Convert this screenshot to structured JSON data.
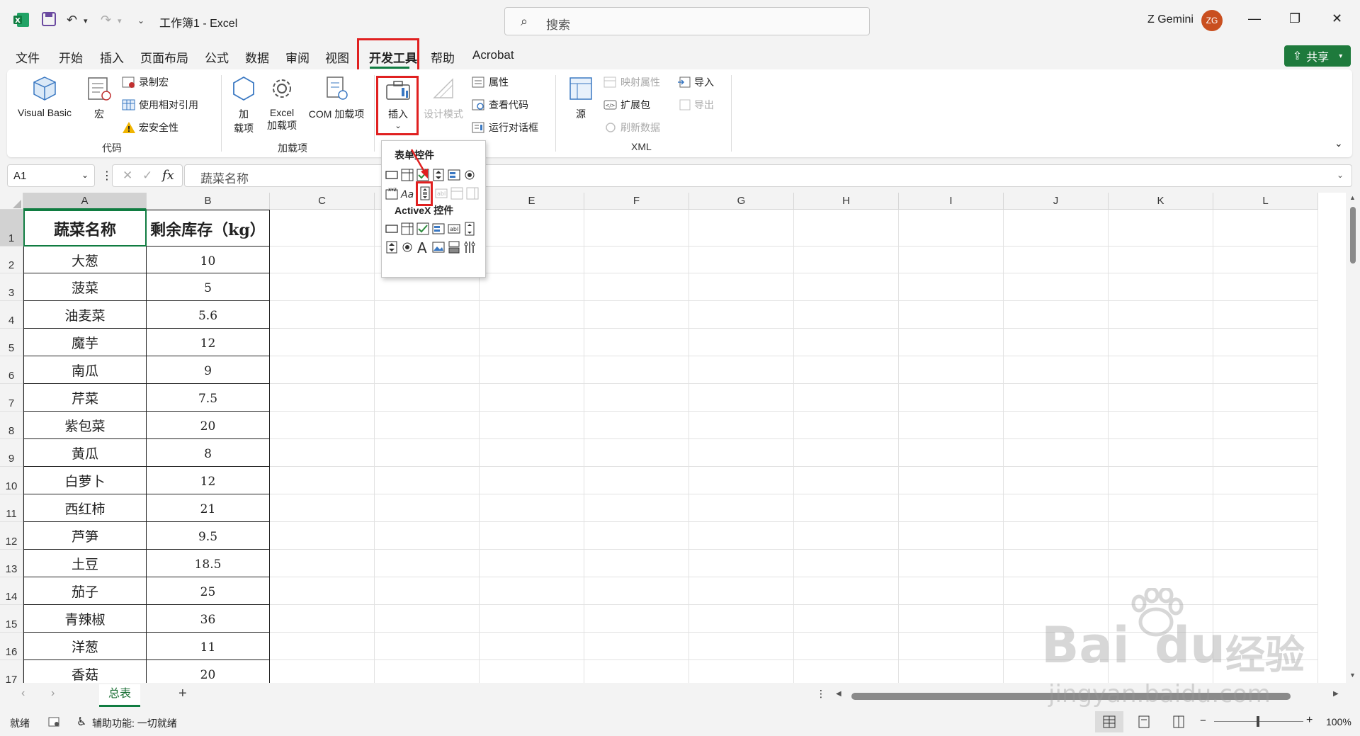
{
  "window": {
    "title": "工作簿1  -  Excel",
    "search_placeholder": "搜索",
    "user_name": "Z Gemini",
    "user_initials": "ZG"
  },
  "menu": {
    "tabs": [
      "文件",
      "开始",
      "插入",
      "页面布局",
      "公式",
      "数据",
      "审阅",
      "视图",
      "开发工具",
      "帮助",
      "Acrobat"
    ],
    "active_tab": "开发工具",
    "share_label": "共享"
  },
  "ribbon": {
    "code_group": {
      "label": "代码",
      "visual_basic": "Visual Basic",
      "macros": "宏",
      "record_macro": "录制宏",
      "relative_ref": "使用相对引用",
      "macro_security": "宏安全性"
    },
    "addins_group": {
      "label": "加载项",
      "addins_line1": "加",
      "addins_line2": "载项",
      "excel_addins_line1": "Excel",
      "excel_addins_line2": "加载项",
      "com_addins": "COM 加载项"
    },
    "controls_group": {
      "insert": "插入",
      "design_mode": "设计模式",
      "properties": "属性",
      "view_code": "查看代码",
      "run_dialog": "运行对话框"
    },
    "xml_group": {
      "label": "XML",
      "source": "源",
      "map_properties": "映射属性",
      "expansion_packs": "扩展包",
      "refresh_data": "刷新数据",
      "import": "导入",
      "export": "导出"
    }
  },
  "insert_dropdown": {
    "form_controls_title": "表单控件",
    "activex_title": "ActiveX 控件"
  },
  "formula_bar": {
    "name_box": "A1",
    "content": "蔬菜名称",
    "fx": "fx"
  },
  "sheet": {
    "columns": [
      "A",
      "B",
      "C",
      "D",
      "E",
      "F",
      "G",
      "H",
      "I",
      "J",
      "K",
      "L"
    ],
    "rows": [
      "1",
      "2",
      "3",
      "4",
      "5",
      "6",
      "7",
      "8",
      "9",
      "10",
      "11",
      "12",
      "13",
      "14",
      "15",
      "16",
      "17"
    ],
    "header": [
      "蔬菜名称",
      "剩余库存（kg）"
    ],
    "data": [
      [
        "大葱",
        "10"
      ],
      [
        "菠菜",
        "5"
      ],
      [
        "油麦菜",
        "5.6"
      ],
      [
        "魔芋",
        "12"
      ],
      [
        "南瓜",
        "9"
      ],
      [
        "芹菜",
        "7.5"
      ],
      [
        "紫包菜",
        "20"
      ],
      [
        "黄瓜",
        "8"
      ],
      [
        "白萝卜",
        "12"
      ],
      [
        "西红柿",
        "21"
      ],
      [
        "芦笋",
        "9.5"
      ],
      [
        "土豆",
        "18.5"
      ],
      [
        "茄子",
        "25"
      ],
      [
        "青辣椒",
        "36"
      ],
      [
        "洋葱",
        "11"
      ],
      [
        "香菇",
        "20"
      ]
    ],
    "tab_name": "总表"
  },
  "status": {
    "ready": "就绪",
    "accessibility": "辅助功能: 一切就绪",
    "zoom": "100%"
  },
  "watermark": {
    "brand": "Bai",
    "brand2": "du",
    "brand_cn": "经验",
    "url": "jingyan.baidu.com"
  },
  "colors": {
    "excel_green": "#107c41",
    "highlight_red": "#e02020",
    "share_green": "#1e7a3c",
    "avatar": "#c94f1f"
  }
}
